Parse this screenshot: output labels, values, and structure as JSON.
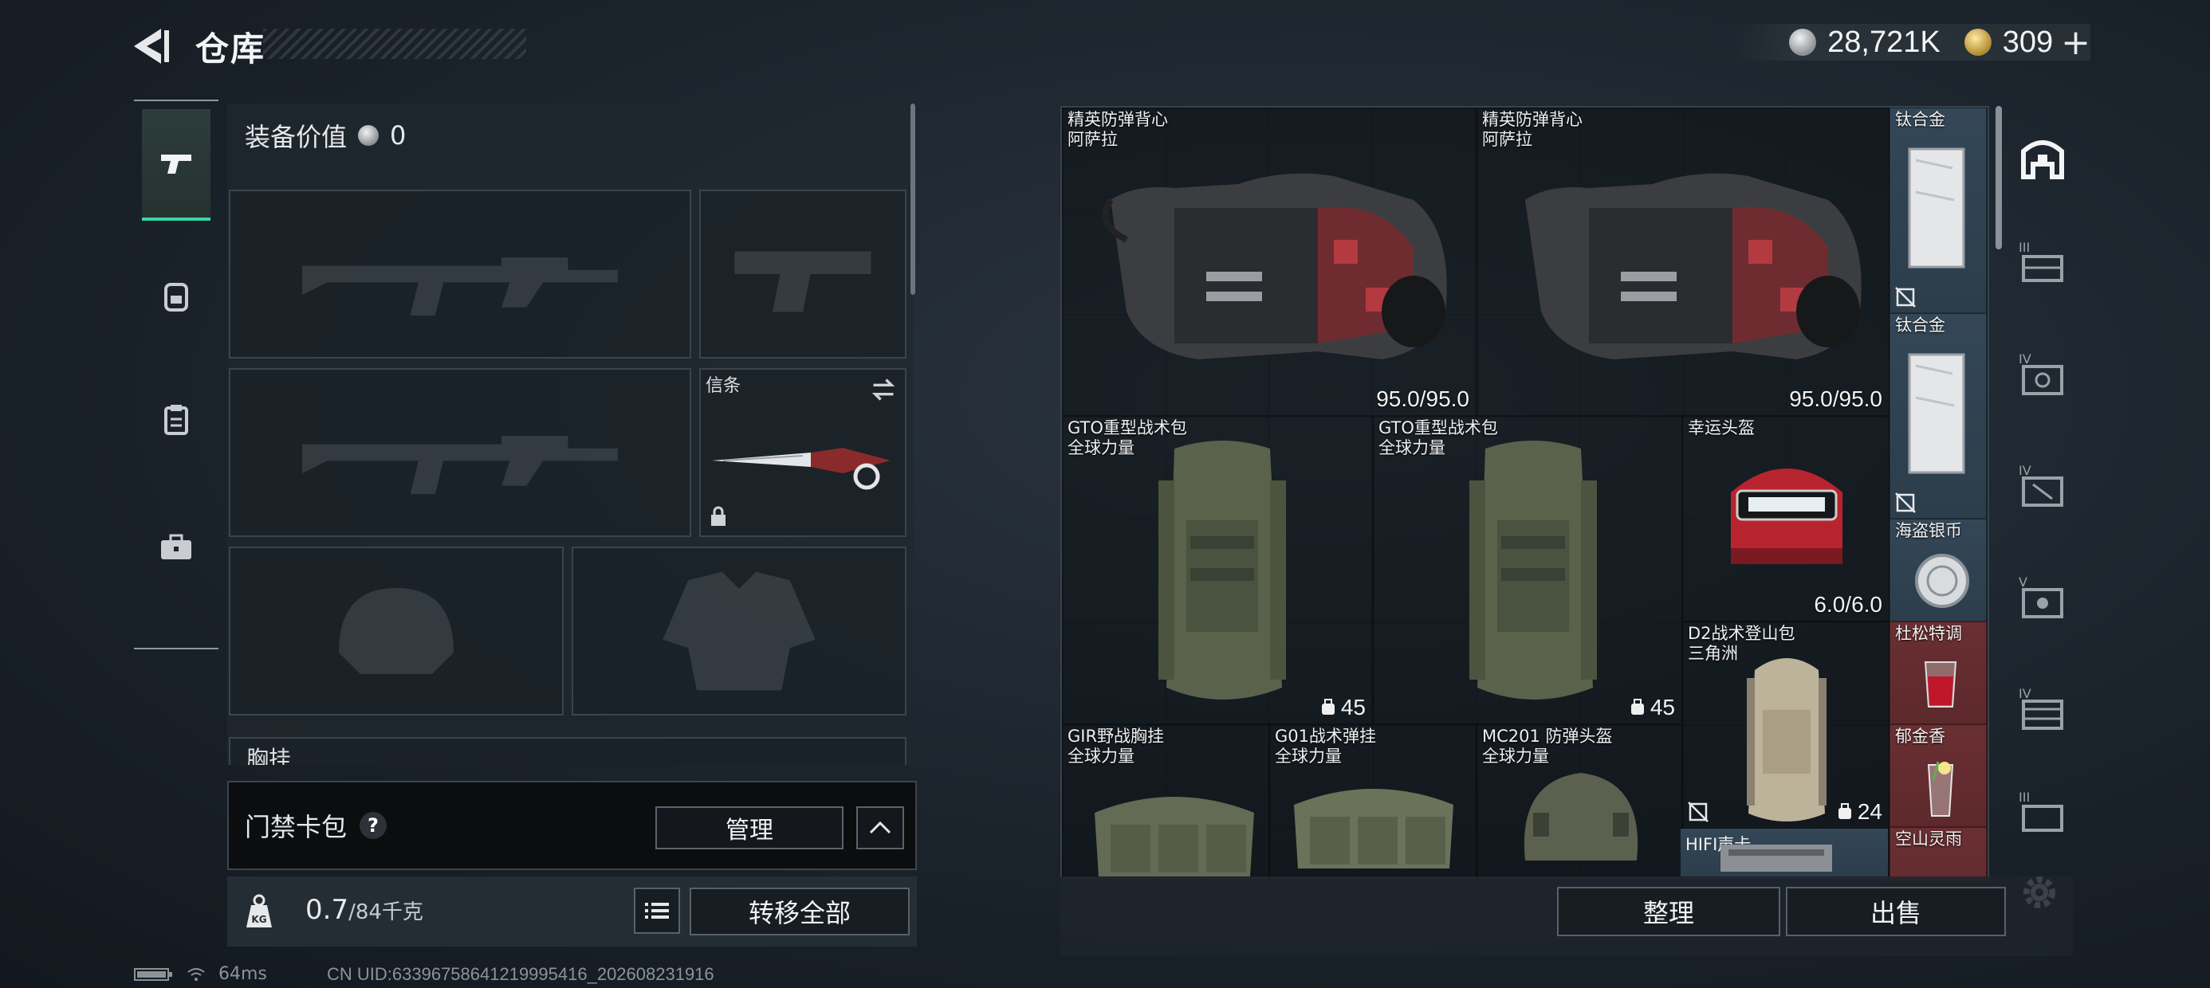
{
  "header": {
    "title": "仓库",
    "currency_silver": "28,721K",
    "currency_gold": "309",
    "plus": "+"
  },
  "equipment": {
    "value_label": "装备价值",
    "value": "0",
    "slots": {
      "primary_weapon_1": "",
      "pistol": "",
      "primary_weapon_2": "",
      "melee_label": "信条",
      "helmet": "",
      "armor": "",
      "chest_rig_label": "胸挂"
    }
  },
  "keycard": {
    "label": "门禁卡包",
    "help": "?",
    "manage": "管理"
  },
  "weight": {
    "current": "0.7",
    "max": "/84千克"
  },
  "actions": {
    "transfer_all": "转移全部",
    "sort": "整理",
    "sell": "出售"
  },
  "status": {
    "ping": "64ms",
    "uid": "CN UID:6339675864121999541​6_202608231916"
  },
  "storage_items": [
    {
      "id": "vest1",
      "name1": "精英防弹背心",
      "name2": "阿萨拉",
      "durability": "95.0/95.0"
    },
    {
      "id": "vest2",
      "name1": "精英防弹背心",
      "name2": "阿萨拉",
      "durability": "95.0/95.0"
    },
    {
      "id": "ti1",
      "name1": "钛合金"
    },
    {
      "id": "ti2",
      "name1": "钛合金"
    },
    {
      "id": "bag1",
      "name1": "GTO重型战术包",
      "name2": "全球力量",
      "capacity": "45"
    },
    {
      "id": "bag2",
      "name1": "GTO重型战术包",
      "name2": "全球力量",
      "capacity": "45"
    },
    {
      "id": "luckyhelm",
      "name1": "幸运头盔",
      "durability": "6.0/6.0"
    },
    {
      "id": "coin",
      "name1": "海盗银币"
    },
    {
      "id": "d2bag",
      "name1": "D2战术登山包",
      "name2": "三角洲",
      "capacity": "24"
    },
    {
      "id": "drink1",
      "name1": "杜松特调"
    },
    {
      "id": "drink2",
      "name1": "郁金香"
    },
    {
      "id": "gir",
      "name1": "GIR野战胸挂",
      "name2": "全球力量"
    },
    {
      "id": "g01",
      "name1": "G01战术弹挂",
      "name2": "全球力量"
    },
    {
      "id": "mc201",
      "name1": "MC201 防弹头盔",
      "name2": "全球力量"
    },
    {
      "id": "hifi",
      "name1": "HIFI声卡"
    },
    {
      "id": "rain",
      "name1": "空山灵雨"
    }
  ],
  "storage_tabs": [
    "home",
    "III",
    "IV",
    "IV",
    "V",
    "IV",
    "III"
  ],
  "colors": {
    "accent": "#35d6a6",
    "cell_brown": "#5e3e35",
    "cell_red": "#6a2f32",
    "cell_blue": "#344757"
  }
}
